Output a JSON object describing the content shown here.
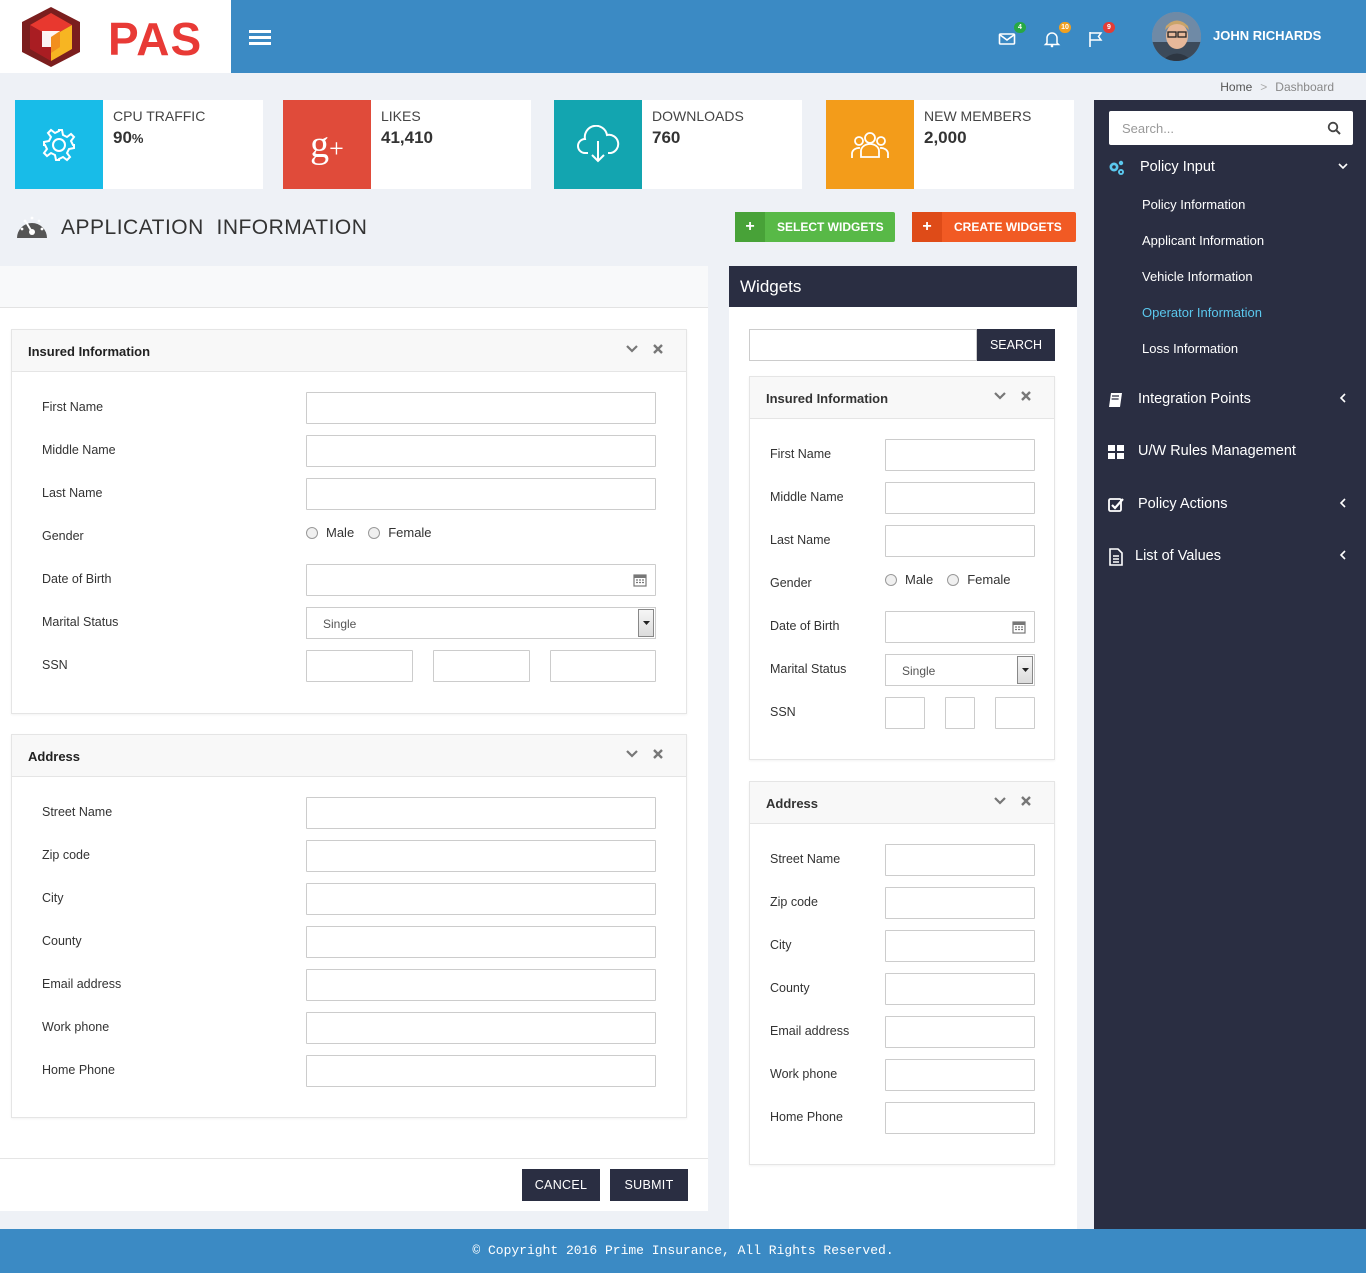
{
  "header": {
    "logo_text": "PAS",
    "user_name": "JOHN RICHARDS",
    "mail_badge": "4",
    "bell_badge": "10",
    "flag_badge": "9",
    "colors": {
      "bar": "#3b8ac4",
      "mail_badge": "#27a844",
      "bell_badge": "#f0a020",
      "flag_badge": "#e33c36"
    }
  },
  "breadcrumb": {
    "home": "Home",
    "separator": ">",
    "current": "Dashboard"
  },
  "stats": [
    {
      "label": "CPU TRAFFIC",
      "value": "90",
      "unit": "%",
      "icon": "gear-icon",
      "color": "#18bce8"
    },
    {
      "label": "LIKES",
      "value": "41,410",
      "icon": "google-plus-icon",
      "color": "#e04b3a"
    },
    {
      "label": "DOWNLOADS",
      "value": "760",
      "icon": "cloud-download-icon",
      "color": "#13a5b0"
    },
    {
      "label": "NEW MEMBERS",
      "value": "2,000",
      "icon": "users-icon",
      "color": "#f39c1a"
    }
  ],
  "page": {
    "title": "APPLICATION  INFORMATION",
    "select_widgets": "SELECT WIDGETS",
    "create_widgets": "CREATE WIDGETS"
  },
  "insured": {
    "title": "Insured Information",
    "first_name": "First Name",
    "middle_name": "Middle Name",
    "last_name": "Last Name",
    "gender": "Gender",
    "male": "Male",
    "female": "Female",
    "dob": "Date of Birth",
    "marital": "Marital Status",
    "marital_value": "Single",
    "ssn": "SSN"
  },
  "address": {
    "title": "Address",
    "street": "Street Name",
    "zip": "Zip code",
    "city": "City",
    "county": "County",
    "email": "Email address",
    "work_phone": "Work phone",
    "home_phone": "Home Phone"
  },
  "actions": {
    "cancel": "CANCEL",
    "submit": "SUBMIT"
  },
  "widgets": {
    "title": "Widgets",
    "search": "SEARCH"
  },
  "sidebar": {
    "search_placeholder": "Search...",
    "policy_input": "Policy Input",
    "sub": [
      "Policy Information",
      "Applicant Information",
      "Vehicle Information",
      "Operator Information",
      "Loss Information"
    ],
    "active_sub": "Operator Information",
    "integration_points": "Integration Points",
    "uw_rules": "U/W Rules Management",
    "policy_actions": "Policy Actions",
    "list_of_values": "List of Values"
  },
  "footer": {
    "copyright": "© Copyright 2016 Prime Insurance, All Rights Reserved."
  }
}
